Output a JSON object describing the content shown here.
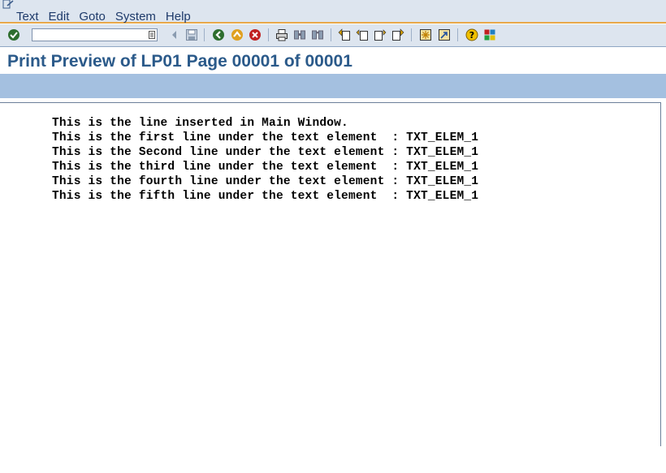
{
  "menu": {
    "items": [
      "Text",
      "Edit",
      "Goto",
      "System",
      "Help"
    ]
  },
  "toolbar": {
    "command_value": "",
    "icons": [
      "enter-icon",
      "command-dropdown-icon",
      "back-arrow-icon",
      "save-icon",
      "back-icon",
      "exit-icon",
      "cancel-icon",
      "print-icon",
      "find-icon",
      "find-next-icon",
      "first-page-icon",
      "previous-page-icon",
      "next-page-icon",
      "last-page-icon",
      "create-session-icon",
      "shortcut-icon",
      "help-icon",
      "customize-layout-icon"
    ]
  },
  "title": "Print Preview of LP01 Page 00001 of 00001",
  "preview": {
    "lines": [
      "This is the line inserted in Main Window.",
      "This is the first line under the text element  : TXT_ELEM_1",
      "This is the Second line under the text element : TXT_ELEM_1",
      "This is the third line under the text element  : TXT_ELEM_1",
      "This is the fourth line under the text element : TXT_ELEM_1",
      "This is the fifth line under the text element  : TXT_ELEM_1"
    ]
  },
  "colors": {
    "menu_bg": "#dde5ef",
    "accent_orange": "#e8a84a",
    "title_text": "#2b5a8a",
    "app_toolbar": "#a4c0e0"
  }
}
